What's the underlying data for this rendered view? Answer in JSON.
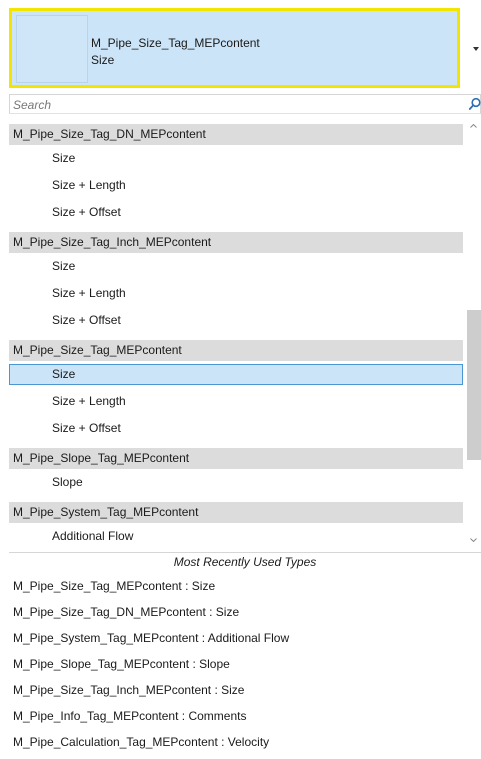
{
  "header": {
    "family_name": "M_Pipe_Size_Tag_MEPcontent",
    "type_name": "Size"
  },
  "search": {
    "placeholder": "Search",
    "value": ""
  },
  "groups": [
    {
      "name": "M_Pipe_Size_Tag_DN_MEPcontent",
      "types": [
        "Size",
        "Size + Length",
        "Size + Offset"
      ]
    },
    {
      "name": "M_Pipe_Size_Tag_Inch_MEPcontent",
      "types": [
        "Size",
        "Size + Length",
        "Size + Offset"
      ]
    },
    {
      "name": "M_Pipe_Size_Tag_MEPcontent",
      "types": [
        "Size",
        "Size + Length",
        "Size + Offset"
      ]
    },
    {
      "name": "M_Pipe_Slope_Tag_MEPcontent",
      "types": [
        "Slope"
      ]
    },
    {
      "name": "M_Pipe_System_Tag_MEPcontent",
      "types": [
        "Additional Flow"
      ]
    }
  ],
  "selected": {
    "group": "M_Pipe_Size_Tag_MEPcontent",
    "type": "Size"
  },
  "mru": {
    "title": "Most Recently Used Types",
    "items": [
      "M_Pipe_Size_Tag_MEPcontent : Size",
      "M_Pipe_Size_Tag_DN_MEPcontent : Size",
      "M_Pipe_System_Tag_MEPcontent : Additional Flow",
      "M_Pipe_Slope_Tag_MEPcontent : Slope",
      "M_Pipe_Size_Tag_Inch_MEPcontent : Size",
      "M_Pipe_Info_Tag_MEPcontent : Comments",
      "M_Pipe_Calculation_Tag_MEPcontent : Velocity"
    ]
  },
  "colors": {
    "header_background": "#cce4f7",
    "highlight_border": "#f2e600",
    "group_row": "#dcdcdc",
    "selected_row": "#cce4f7",
    "selected_border": "#4a97d3"
  }
}
